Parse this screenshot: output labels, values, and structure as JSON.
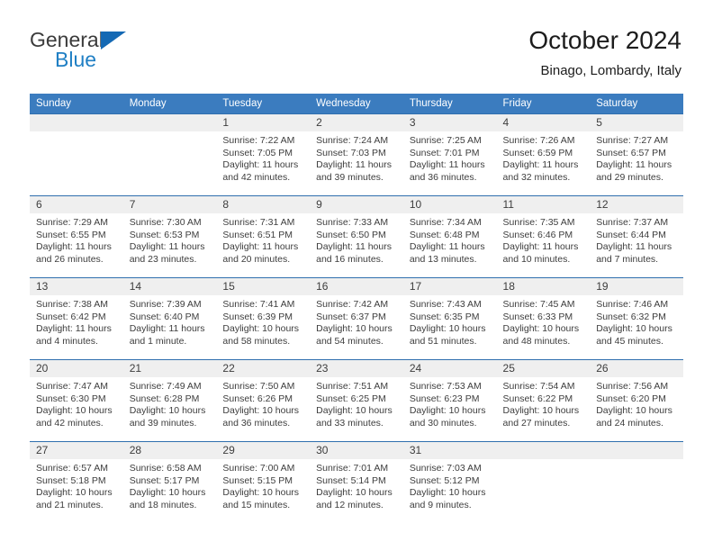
{
  "logo": {
    "word_top": "General",
    "word_bottom": "Blue",
    "triangle_icon": "triangle-icon",
    "color_blue": "#1f7fc4",
    "color_dark": "#3b3b3b"
  },
  "header": {
    "title": "October 2024",
    "subtitle": "Binago, Lombardy, Italy"
  },
  "theme": {
    "header_blue": "#3b7cbf",
    "row_border_blue": "#2f6fae",
    "daynum_band": "#efefef"
  },
  "calendar": {
    "weekday_headers": [
      "Sunday",
      "Monday",
      "Tuesday",
      "Wednesday",
      "Thursday",
      "Friday",
      "Saturday"
    ],
    "labels": {
      "sunrise": "Sunrise:",
      "sunset": "Sunset:",
      "daylight": "Daylight:"
    },
    "weeks": [
      [
        {
          "day": "",
          "sunrise": "",
          "sunset": "",
          "daylight": ""
        },
        {
          "day": "",
          "sunrise": "",
          "sunset": "",
          "daylight": ""
        },
        {
          "day": "1",
          "sunrise": "Sunrise: 7:22 AM",
          "sunset": "Sunset: 7:05 PM",
          "daylight": "Daylight: 11 hours and 42 minutes."
        },
        {
          "day": "2",
          "sunrise": "Sunrise: 7:24 AM",
          "sunset": "Sunset: 7:03 PM",
          "daylight": "Daylight: 11 hours and 39 minutes."
        },
        {
          "day": "3",
          "sunrise": "Sunrise: 7:25 AM",
          "sunset": "Sunset: 7:01 PM",
          "daylight": "Daylight: 11 hours and 36 minutes."
        },
        {
          "day": "4",
          "sunrise": "Sunrise: 7:26 AM",
          "sunset": "Sunset: 6:59 PM",
          "daylight": "Daylight: 11 hours and 32 minutes."
        },
        {
          "day": "5",
          "sunrise": "Sunrise: 7:27 AM",
          "sunset": "Sunset: 6:57 PM",
          "daylight": "Daylight: 11 hours and 29 minutes."
        }
      ],
      [
        {
          "day": "6",
          "sunrise": "Sunrise: 7:29 AM",
          "sunset": "Sunset: 6:55 PM",
          "daylight": "Daylight: 11 hours and 26 minutes."
        },
        {
          "day": "7",
          "sunrise": "Sunrise: 7:30 AM",
          "sunset": "Sunset: 6:53 PM",
          "daylight": "Daylight: 11 hours and 23 minutes."
        },
        {
          "day": "8",
          "sunrise": "Sunrise: 7:31 AM",
          "sunset": "Sunset: 6:51 PM",
          "daylight": "Daylight: 11 hours and 20 minutes."
        },
        {
          "day": "9",
          "sunrise": "Sunrise: 7:33 AM",
          "sunset": "Sunset: 6:50 PM",
          "daylight": "Daylight: 11 hours and 16 minutes."
        },
        {
          "day": "10",
          "sunrise": "Sunrise: 7:34 AM",
          "sunset": "Sunset: 6:48 PM",
          "daylight": "Daylight: 11 hours and 13 minutes."
        },
        {
          "day": "11",
          "sunrise": "Sunrise: 7:35 AM",
          "sunset": "Sunset: 6:46 PM",
          "daylight": "Daylight: 11 hours and 10 minutes."
        },
        {
          "day": "12",
          "sunrise": "Sunrise: 7:37 AM",
          "sunset": "Sunset: 6:44 PM",
          "daylight": "Daylight: 11 hours and 7 minutes."
        }
      ],
      [
        {
          "day": "13",
          "sunrise": "Sunrise: 7:38 AM",
          "sunset": "Sunset: 6:42 PM",
          "daylight": "Daylight: 11 hours and 4 minutes."
        },
        {
          "day": "14",
          "sunrise": "Sunrise: 7:39 AM",
          "sunset": "Sunset: 6:40 PM",
          "daylight": "Daylight: 11 hours and 1 minute."
        },
        {
          "day": "15",
          "sunrise": "Sunrise: 7:41 AM",
          "sunset": "Sunset: 6:39 PM",
          "daylight": "Daylight: 10 hours and 58 minutes."
        },
        {
          "day": "16",
          "sunrise": "Sunrise: 7:42 AM",
          "sunset": "Sunset: 6:37 PM",
          "daylight": "Daylight: 10 hours and 54 minutes."
        },
        {
          "day": "17",
          "sunrise": "Sunrise: 7:43 AM",
          "sunset": "Sunset: 6:35 PM",
          "daylight": "Daylight: 10 hours and 51 minutes."
        },
        {
          "day": "18",
          "sunrise": "Sunrise: 7:45 AM",
          "sunset": "Sunset: 6:33 PM",
          "daylight": "Daylight: 10 hours and 48 minutes."
        },
        {
          "day": "19",
          "sunrise": "Sunrise: 7:46 AM",
          "sunset": "Sunset: 6:32 PM",
          "daylight": "Daylight: 10 hours and 45 minutes."
        }
      ],
      [
        {
          "day": "20",
          "sunrise": "Sunrise: 7:47 AM",
          "sunset": "Sunset: 6:30 PM",
          "daylight": "Daylight: 10 hours and 42 minutes."
        },
        {
          "day": "21",
          "sunrise": "Sunrise: 7:49 AM",
          "sunset": "Sunset: 6:28 PM",
          "daylight": "Daylight: 10 hours and 39 minutes."
        },
        {
          "day": "22",
          "sunrise": "Sunrise: 7:50 AM",
          "sunset": "Sunset: 6:26 PM",
          "daylight": "Daylight: 10 hours and 36 minutes."
        },
        {
          "day": "23",
          "sunrise": "Sunrise: 7:51 AM",
          "sunset": "Sunset: 6:25 PM",
          "daylight": "Daylight: 10 hours and 33 minutes."
        },
        {
          "day": "24",
          "sunrise": "Sunrise: 7:53 AM",
          "sunset": "Sunset: 6:23 PM",
          "daylight": "Daylight: 10 hours and 30 minutes."
        },
        {
          "day": "25",
          "sunrise": "Sunrise: 7:54 AM",
          "sunset": "Sunset: 6:22 PM",
          "daylight": "Daylight: 10 hours and 27 minutes."
        },
        {
          "day": "26",
          "sunrise": "Sunrise: 7:56 AM",
          "sunset": "Sunset: 6:20 PM",
          "daylight": "Daylight: 10 hours and 24 minutes."
        }
      ],
      [
        {
          "day": "27",
          "sunrise": "Sunrise: 6:57 AM",
          "sunset": "Sunset: 5:18 PM",
          "daylight": "Daylight: 10 hours and 21 minutes."
        },
        {
          "day": "28",
          "sunrise": "Sunrise: 6:58 AM",
          "sunset": "Sunset: 5:17 PM",
          "daylight": "Daylight: 10 hours and 18 minutes."
        },
        {
          "day": "29",
          "sunrise": "Sunrise: 7:00 AM",
          "sunset": "Sunset: 5:15 PM",
          "daylight": "Daylight: 10 hours and 15 minutes."
        },
        {
          "day": "30",
          "sunrise": "Sunrise: 7:01 AM",
          "sunset": "Sunset: 5:14 PM",
          "daylight": "Daylight: 10 hours and 12 minutes."
        },
        {
          "day": "31",
          "sunrise": "Sunrise: 7:03 AM",
          "sunset": "Sunset: 5:12 PM",
          "daylight": "Daylight: 10 hours and 9 minutes."
        },
        {
          "day": "",
          "sunrise": "",
          "sunset": "",
          "daylight": ""
        },
        {
          "day": "",
          "sunrise": "",
          "sunset": "",
          "daylight": ""
        }
      ]
    ]
  }
}
